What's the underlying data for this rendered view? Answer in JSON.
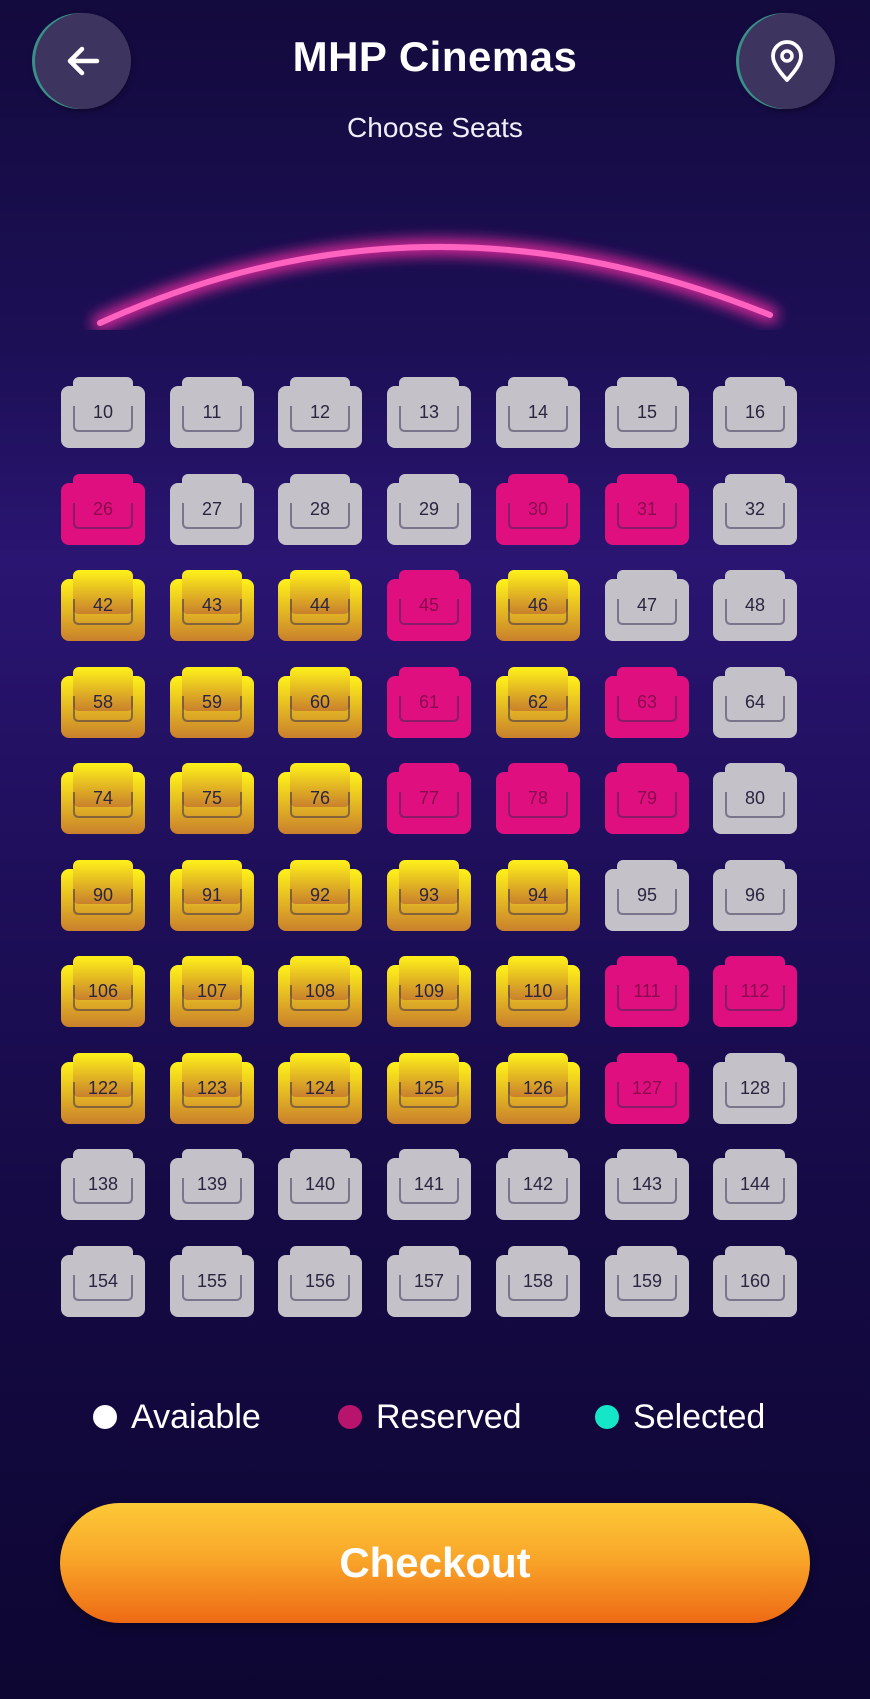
{
  "header": {
    "title": "MHP Cinemas",
    "subtitle": "Choose Seats",
    "back_icon": "arrow-left-icon",
    "location_icon": "map-pin-icon"
  },
  "seats": [
    [
      {
        "n": "10",
        "s": "available"
      },
      {
        "n": "11",
        "s": "available"
      },
      {
        "n": "12",
        "s": "available"
      },
      {
        "n": "13",
        "s": "available"
      },
      {
        "n": "14",
        "s": "available"
      },
      {
        "n": "15",
        "s": "available"
      },
      {
        "n": "16",
        "s": "available"
      }
    ],
    [
      {
        "n": "26",
        "s": "reserved"
      },
      {
        "n": "27",
        "s": "available"
      },
      {
        "n": "28",
        "s": "available"
      },
      {
        "n": "29",
        "s": "available"
      },
      {
        "n": "30",
        "s": "reserved"
      },
      {
        "n": "31",
        "s": "reserved"
      },
      {
        "n": "32",
        "s": "available"
      }
    ],
    [
      {
        "n": "42",
        "s": "gold"
      },
      {
        "n": "43",
        "s": "gold"
      },
      {
        "n": "44",
        "s": "gold"
      },
      {
        "n": "45",
        "s": "reserved"
      },
      {
        "n": "46",
        "s": "gold"
      },
      {
        "n": "47",
        "s": "available"
      },
      {
        "n": "48",
        "s": "available"
      }
    ],
    [
      {
        "n": "58",
        "s": "gold"
      },
      {
        "n": "59",
        "s": "gold"
      },
      {
        "n": "60",
        "s": "gold"
      },
      {
        "n": "61",
        "s": "reserved"
      },
      {
        "n": "62",
        "s": "gold"
      },
      {
        "n": "63",
        "s": "reserved"
      },
      {
        "n": "64",
        "s": "available"
      }
    ],
    [
      {
        "n": "74",
        "s": "gold"
      },
      {
        "n": "75",
        "s": "gold"
      },
      {
        "n": "76",
        "s": "gold"
      },
      {
        "n": "77",
        "s": "reserved"
      },
      {
        "n": "78",
        "s": "reserved"
      },
      {
        "n": "79",
        "s": "reserved"
      },
      {
        "n": "80",
        "s": "available"
      }
    ],
    [
      {
        "n": "90",
        "s": "gold"
      },
      {
        "n": "91",
        "s": "gold"
      },
      {
        "n": "92",
        "s": "gold"
      },
      {
        "n": "93",
        "s": "gold"
      },
      {
        "n": "94",
        "s": "gold"
      },
      {
        "n": "95",
        "s": "available"
      },
      {
        "n": "96",
        "s": "available"
      }
    ],
    [
      {
        "n": "106",
        "s": "gold"
      },
      {
        "n": "107",
        "s": "gold"
      },
      {
        "n": "108",
        "s": "gold"
      },
      {
        "n": "109",
        "s": "gold"
      },
      {
        "n": "110",
        "s": "gold"
      },
      {
        "n": "111",
        "s": "reserved"
      },
      {
        "n": "112",
        "s": "reserved"
      }
    ],
    [
      {
        "n": "122",
        "s": "gold"
      },
      {
        "n": "123",
        "s": "gold"
      },
      {
        "n": "124",
        "s": "gold"
      },
      {
        "n": "125",
        "s": "gold"
      },
      {
        "n": "126",
        "s": "gold"
      },
      {
        "n": "127",
        "s": "reserved"
      },
      {
        "n": "128",
        "s": "available"
      }
    ],
    [
      {
        "n": "138",
        "s": "available"
      },
      {
        "n": "139",
        "s": "available"
      },
      {
        "n": "140",
        "s": "available"
      },
      {
        "n": "141",
        "s": "available"
      },
      {
        "n": "142",
        "s": "available"
      },
      {
        "n": "143",
        "s": "available"
      },
      {
        "n": "144",
        "s": "available"
      }
    ],
    [
      {
        "n": "154",
        "s": "available"
      },
      {
        "n": "155",
        "s": "available"
      },
      {
        "n": "156",
        "s": "available"
      },
      {
        "n": "157",
        "s": "available"
      },
      {
        "n": "158",
        "s": "available"
      },
      {
        "n": "159",
        "s": "available"
      },
      {
        "n": "160",
        "s": "available"
      }
    ]
  ],
  "legend": [
    {
      "label": "Avaiable",
      "color": "#ffffff"
    },
    {
      "label": "Reserved",
      "color": "#b8146e"
    },
    {
      "label": "Selected",
      "color": "#15e6c9"
    }
  ],
  "colors": {
    "available": "#c4c2c8",
    "reserved": "#e00f80",
    "gold_top": "#fff21a",
    "gold_bottom": "#c9802c",
    "screen_glow": "#ff4fb5",
    "checkout": "#f7a12b"
  },
  "checkout_label": "Checkout"
}
